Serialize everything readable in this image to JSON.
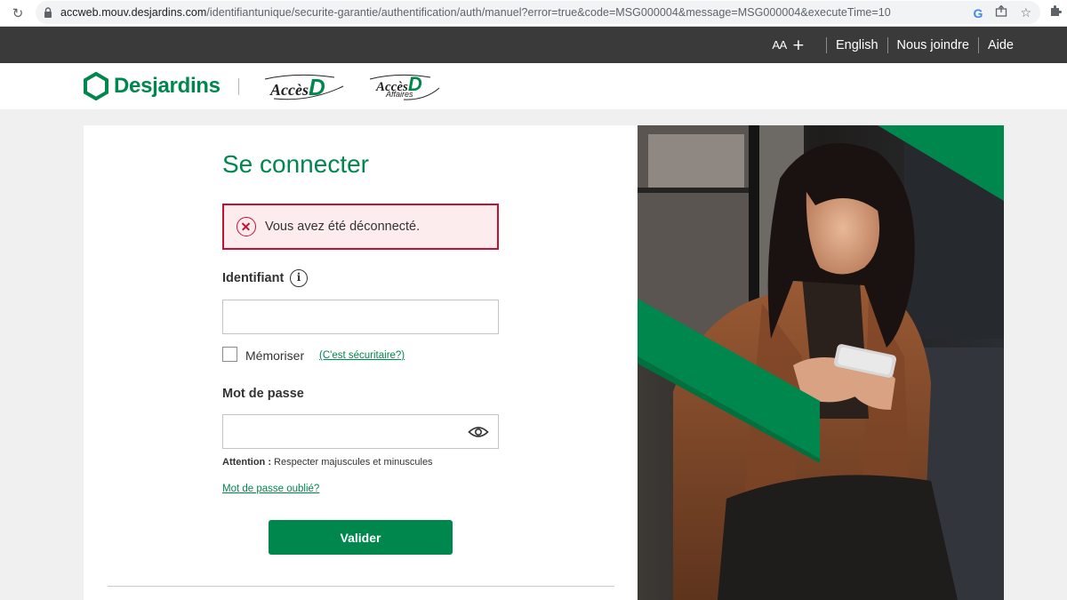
{
  "browser": {
    "url_host": "accweb.mouv.desjardins.com",
    "url_path": "/identifiantunique/securite-garantie/authentification/auth/manuel?error=true&code=MSG000004&message=MSG000004&executeTime=10"
  },
  "topnav": {
    "text_size_label": "AA",
    "text_size_increase": "+",
    "language_label": "English",
    "contact_label": "Nous joindre",
    "help_label": "Aide"
  },
  "header": {
    "brand": "Desjardins",
    "accesd_text": "Accès",
    "accesd_letter": "D",
    "accesd_affaires_text": "Accès",
    "accesd_affaires_letter": "D",
    "accesd_affaires_sub": "Affaires"
  },
  "login": {
    "title": "Se connecter",
    "alert_message": "Vous avez été déconnecté.",
    "identifier_label": "Identifiant",
    "identifier_value": "",
    "remember_label": "Mémoriser",
    "remember_checked": false,
    "secure_link": "(C'est sécuritaire?)",
    "password_label": "Mot de passe",
    "password_value": "",
    "hint_bold": "Attention :",
    "hint_text": " Respecter majuscules et minuscules",
    "forgot_link": "Mot de passe oublié?",
    "submit_label": "Valider"
  },
  "colors": {
    "brand_green": "#00874e",
    "error_red": "#c8102e",
    "topnav_bg": "#3a3a3a"
  },
  "icons": {
    "reload": "reload-icon",
    "lock": "lock-icon",
    "google": "google-icon",
    "share": "share-icon",
    "bookmark": "star-icon",
    "extensions": "puzzle-icon",
    "alert": "error-circle-x-icon",
    "info": "info-icon",
    "password_visibility": "eye-icon"
  }
}
